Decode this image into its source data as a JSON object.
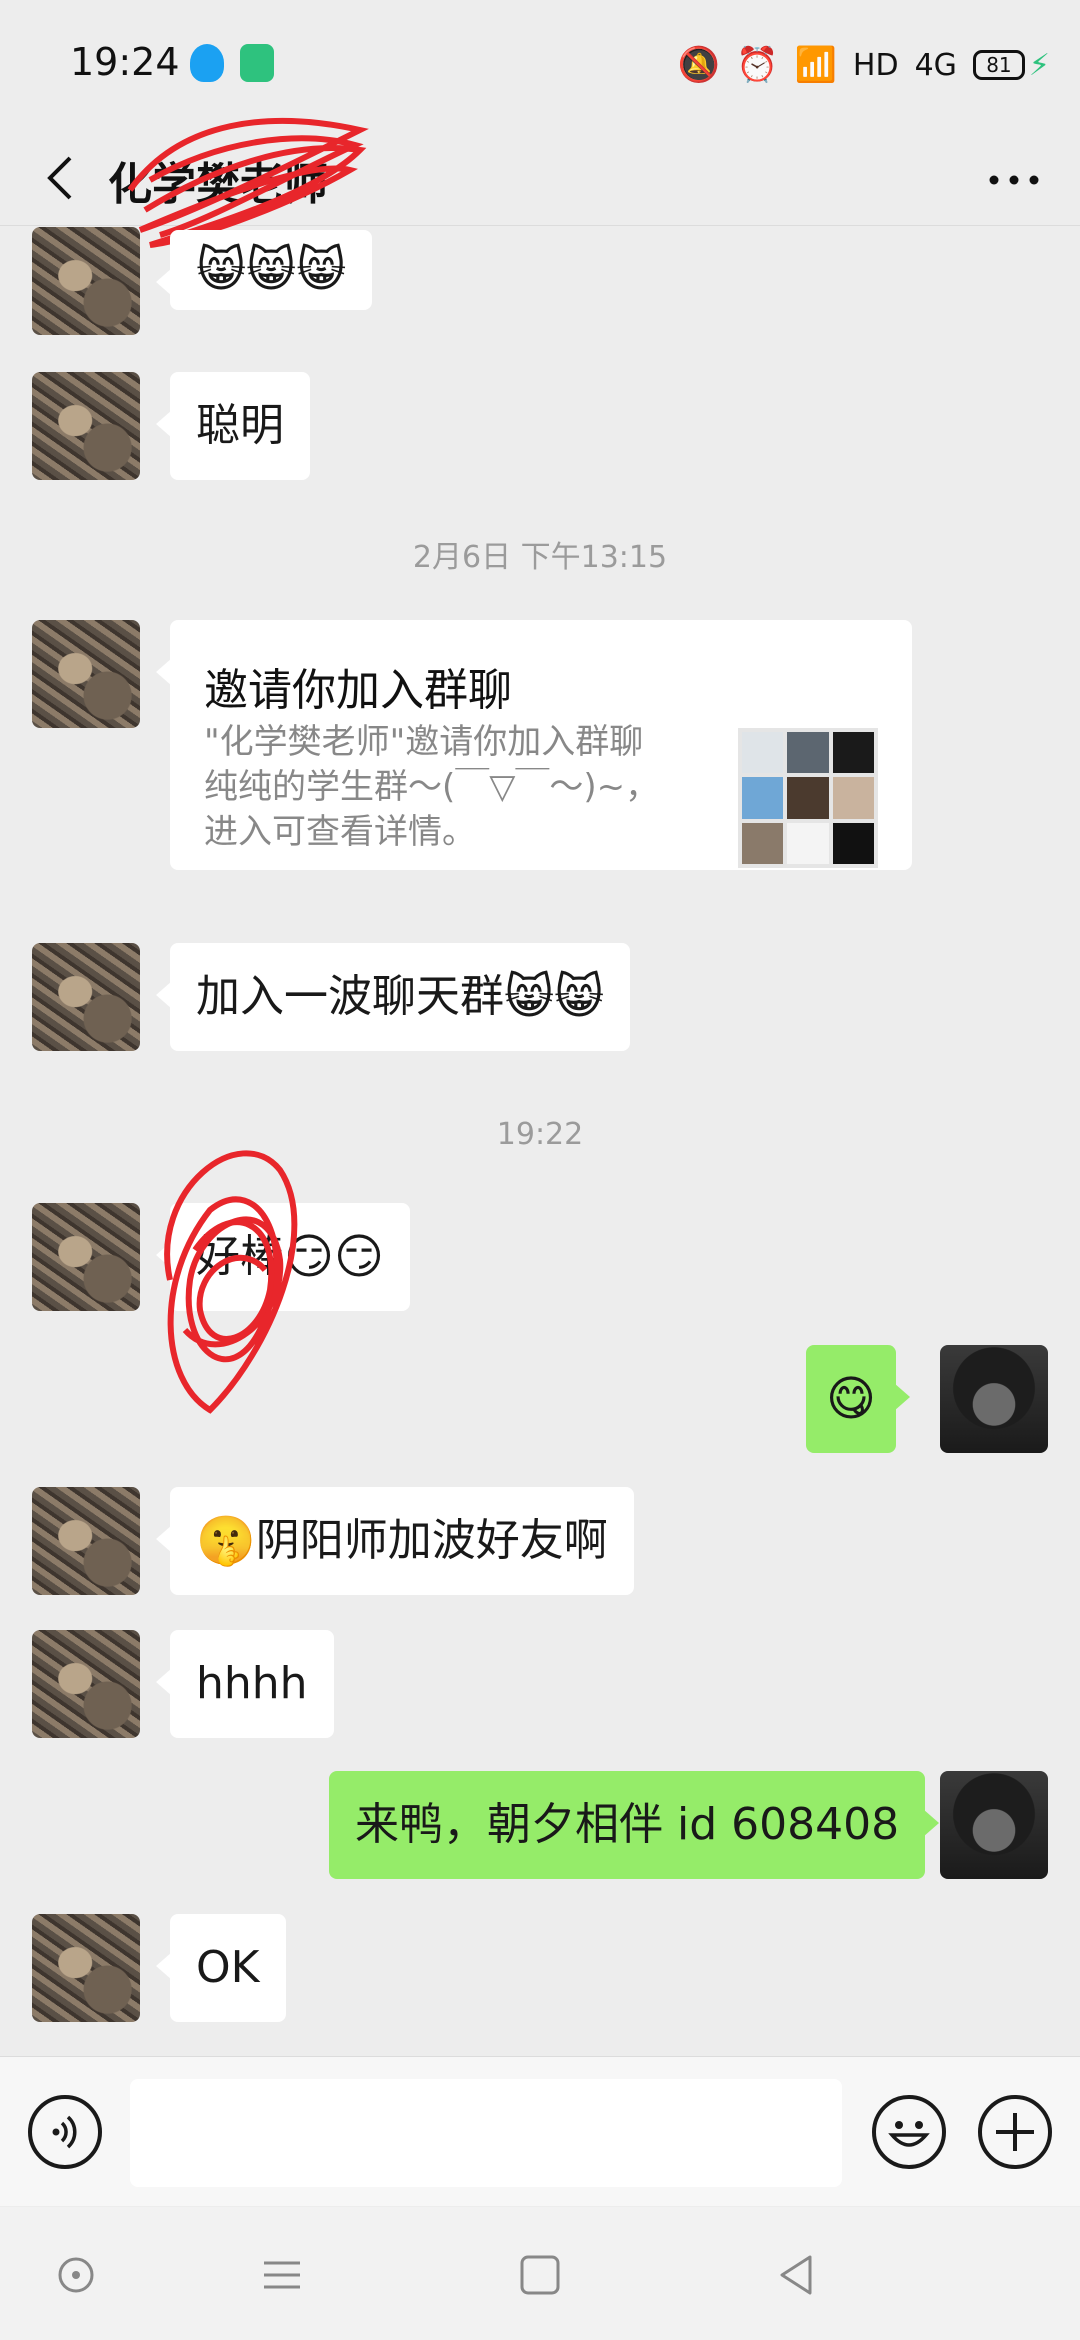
{
  "status_bar": {
    "time": "19:24",
    "network_label": "HD",
    "signal_label": "4G",
    "battery": "81"
  },
  "header": {
    "title": "化学樊老师"
  },
  "messages": {
    "m1_text": "",
    "m2_text": "聪明",
    "ts1": "2月6日 下午13:15",
    "invite": {
      "title": "邀请你加入群聊",
      "desc": "\"化学樊老师\"邀请你加入群聊纯纯的学生群～(￣▽￣～)~，进入可查看详情。"
    },
    "m3_text": "加入一波聊天群",
    "ts2": "19:22",
    "m4_text": "好棒",
    "m6_text": "阴阳师加波好友啊",
    "m7_text": "hhhh",
    "m8_text": "来鸭，朝夕相伴 id 608408",
    "m9_text": "OK"
  },
  "input": {
    "placeholder": ""
  },
  "colors": {
    "background": "#ededed",
    "self_bubble": "#95ec69",
    "other_bubble": "#ffffff",
    "scribble": "#e8262b"
  }
}
